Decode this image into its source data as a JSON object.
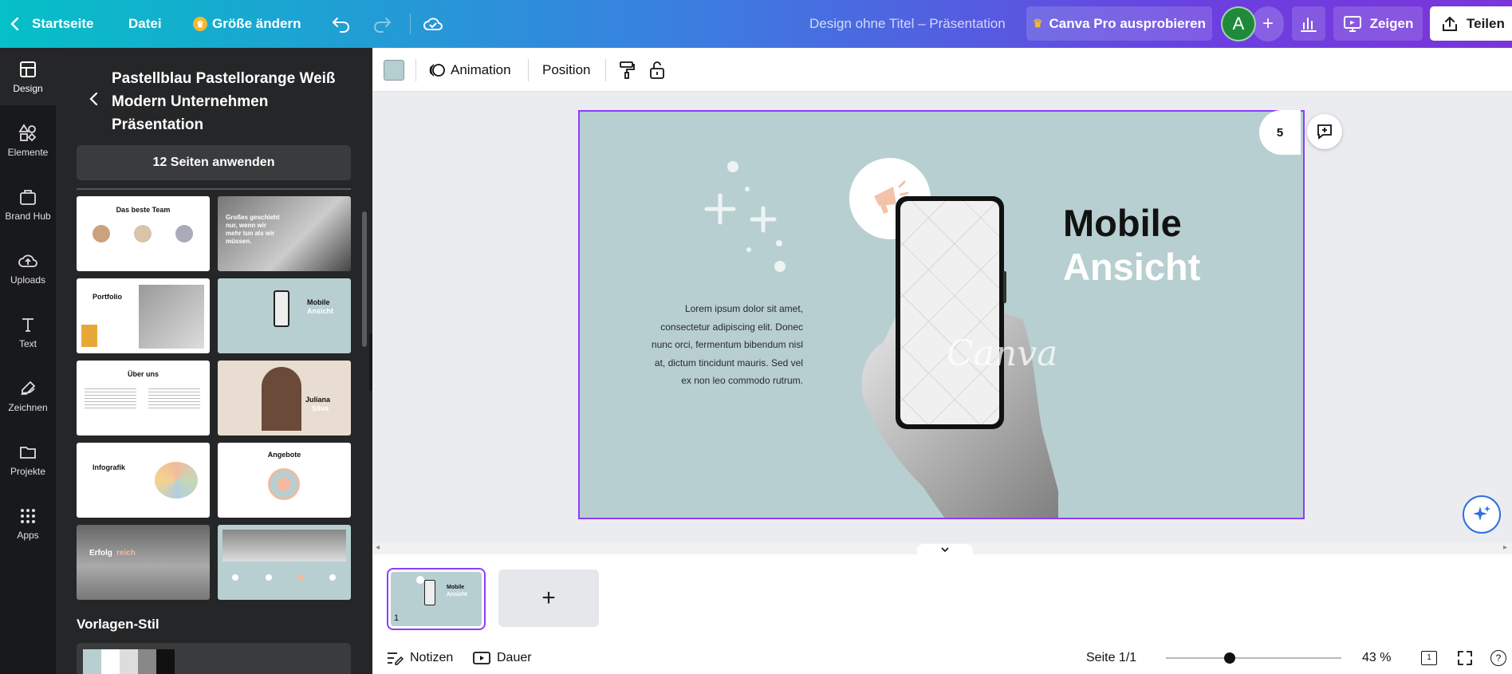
{
  "topbar": {
    "home_label": "Startseite",
    "file_label": "Datei",
    "resize_label": "Größe ändern",
    "doc_title": "Design ohne Titel – Präsentation",
    "pro_label": "Canva Pro ausprobieren",
    "avatar_letter": "A",
    "present_label": "Zeigen",
    "share_label": "Teilen"
  },
  "rail": {
    "items": [
      {
        "label": "Design",
        "icon": "layout-icon"
      },
      {
        "label": "Elemente",
        "icon": "shapes-icon"
      },
      {
        "label": "Brand Hub",
        "icon": "brand-icon"
      },
      {
        "label": "Uploads",
        "icon": "cloud-upload-icon"
      },
      {
        "label": "Text",
        "icon": "text-icon"
      },
      {
        "label": "Zeichnen",
        "icon": "draw-icon"
      },
      {
        "label": "Projekte",
        "icon": "folder-icon"
      },
      {
        "label": "Apps",
        "icon": "apps-grid-icon"
      }
    ]
  },
  "panel": {
    "title": "Pastellblau Pastellorange Weiß Modern Unternehmen Präsentation",
    "apply_label": "12 Seiten anwenden",
    "thumbs": [
      {
        "title": "Das beste Team",
        "theme": "light"
      },
      {
        "title": "Großes geschieht nur, wenn wir mehr tun als wir müssen.",
        "theme": "photo-dark"
      },
      {
        "title": "Portfolio",
        "theme": "light"
      },
      {
        "title": "Mobile",
        "subtitle": "Ansicht",
        "theme": "teal"
      },
      {
        "title": "Über uns",
        "theme": "light"
      },
      {
        "title": "Juliana",
        "subtitle": "Silva",
        "theme": "beige"
      },
      {
        "title": "Infografik",
        "theme": "light"
      },
      {
        "title": "Angebote",
        "theme": "light"
      },
      {
        "title": "Erfolg",
        "subtitle": "reich",
        "theme": "photo-dark"
      },
      {
        "title": "",
        "theme": "photo-teal"
      }
    ],
    "style_section_title": "Vorlagen-Stil"
  },
  "toolbar": {
    "color_hex": "#b5ced0",
    "animation_label": "Animation",
    "position_label": "Position"
  },
  "slide": {
    "title_black": "Mobile",
    "title_white": "Ansicht",
    "body_text": "Lorem ipsum dolor sit amet, consectetur adipiscing elit. Donec nunc orci, fermentum bibendum nisl at, dictum tincidunt mauris. Sed vel ex non leo commodo rutrum.",
    "watermark": "Canva",
    "page_number": "5",
    "background_hex": "#b7cfd0"
  },
  "pages": {
    "thumb_number": "1",
    "thumb_title_black": "Mobile",
    "thumb_title_white": "Ansicht"
  },
  "footer": {
    "notes_label": "Notizen",
    "duration_label": "Dauer",
    "page_indicator": "Seite 1/1",
    "zoom": "43 %",
    "page_count": "1",
    "help_label": "?"
  }
}
